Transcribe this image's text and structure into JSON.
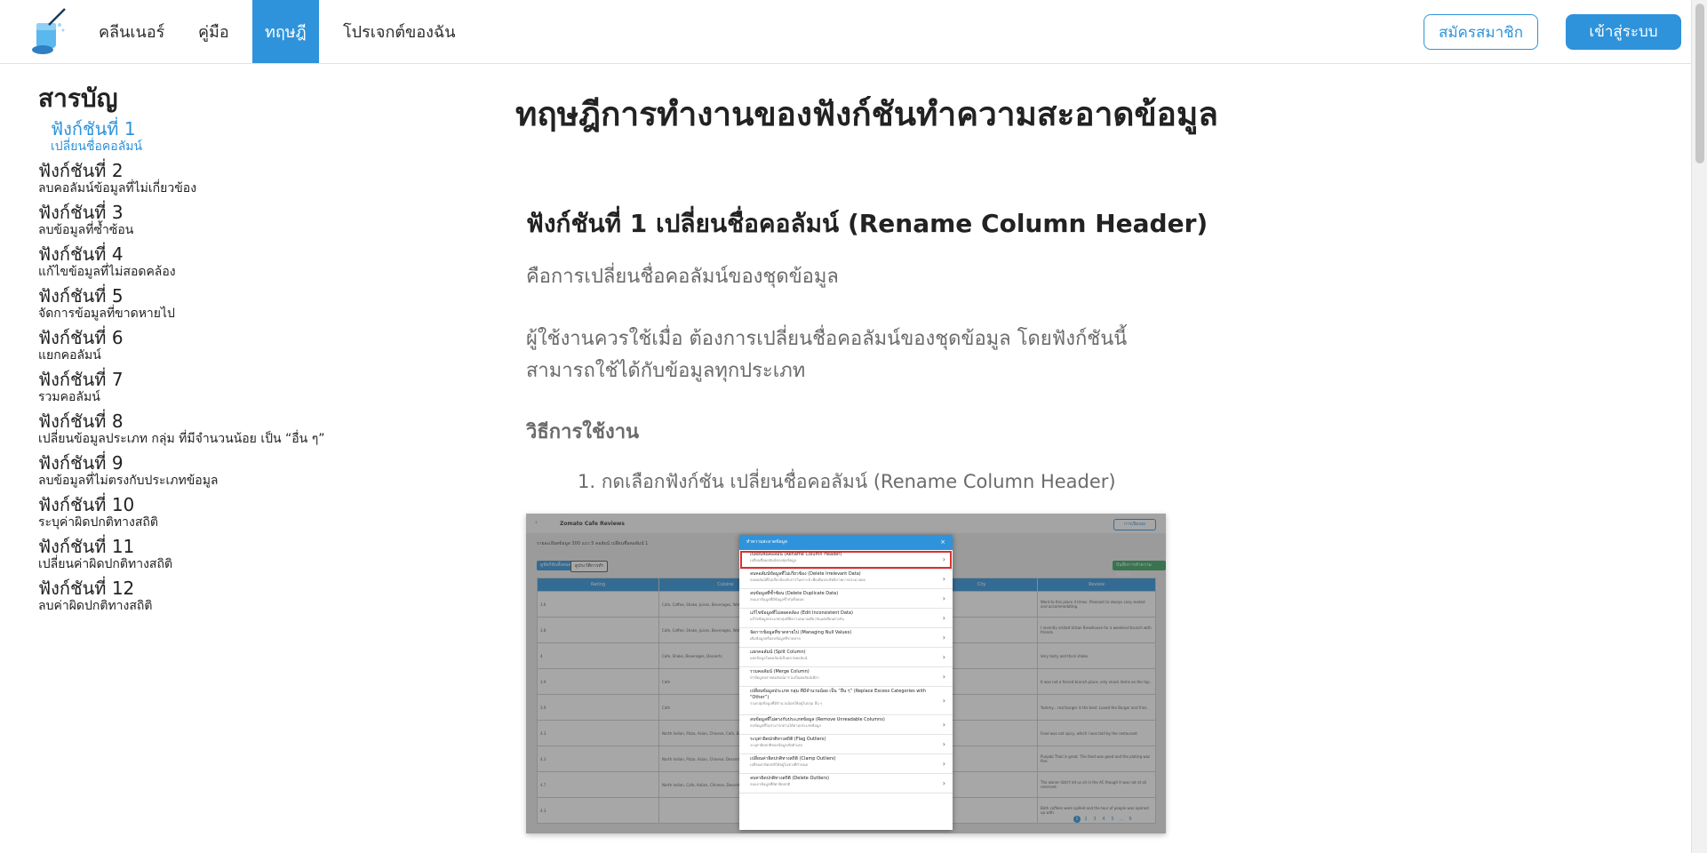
{
  "nav": {
    "links": [
      {
        "label": "คลีนเนอร์"
      },
      {
        "label": "คู่มือ"
      },
      {
        "label": "ทฤษฎี"
      },
      {
        "label": "โปรเจกต์ของฉัน"
      }
    ],
    "signup_label": "สมัครสมาชิก",
    "login_label": "เข้าสู่ระบบ"
  },
  "toc": {
    "title": "สารบัญ",
    "items": [
      {
        "num": "ฟังก์ชันที่ 1",
        "sub": "เปลี่ยนชื่อคอลัมน์"
      },
      {
        "num": "ฟังก์ชันที่ 2",
        "sub": "ลบคอลัมน์ข้อมูลที่ไม่เกี่ยวข้อง"
      },
      {
        "num": "ฟังก์ชันที่ 3",
        "sub": "ลบข้อมูลที่ซ้ำซ้อน"
      },
      {
        "num": "ฟังก์ชันที่ 4",
        "sub": "แก้ไขข้อมูลที่ไม่สอดคล้อง"
      },
      {
        "num": "ฟังก์ชันที่ 5",
        "sub": "จัดการข้อมูลที่ขาดหายไป"
      },
      {
        "num": "ฟังก์ชันที่ 6",
        "sub": "แยกคอลัมน์"
      },
      {
        "num": "ฟังก์ชันที่ 7",
        "sub": "รวมคอลัมน์"
      },
      {
        "num": "ฟังก์ชันที่ 8",
        "sub": "เปลี่ยนข้อมูลประเภท กลุ่ม ที่มีจำนวนน้อย เป็น “อื่น ๆ”"
      },
      {
        "num": "ฟังก์ชันที่ 9",
        "sub": "ลบข้อมูลที่ไม่ตรงกับประเภทข้อมูล"
      },
      {
        "num": "ฟังก์ชันที่ 10",
        "sub": "ระบุค่าผิดปกติทางสถิติ"
      },
      {
        "num": "ฟังก์ชันที่ 11",
        "sub": "เปลี่ยนค่าผิดปกติทางสถิติ"
      },
      {
        "num": "ฟังก์ชันที่ 12",
        "sub": "ลบค่าผิดปกติทางสถิติ"
      }
    ]
  },
  "main": {
    "title": "ทฤษฎีการทำงานของฟังก์ชันทำความสะอาดข้อมูล",
    "section_title": "ฟังก์ชันที่ 1 เปลี่ยนชื่อคอลัมน์ (Rename Column Header)",
    "para1": "คือการเปลี่ยนชื่อคอลัมน์ของชุดข้อมูล",
    "para2": "ผู้ใช้งานควรใช้เมื่อ ต้องการเปลี่ยนชื่อคอลัมน์ของชุดข้อมูล โดยฟังก์ชันนี้สามารถใช้ได้กับข้อมูลทุกประเภท",
    "usage_title": "วิธีการใช้งาน",
    "step1": "1. กดเลือกฟังก์ชัน เปลี่ยนชื่อคอลัมน์ (Rename Column Header)"
  },
  "screenshot": {
    "app_title": "Zomato Cafe Reviews",
    "export_label": "การเปิดเผย",
    "info": "รายละเอียดข้อมูล   300 แถว 5 คอลัมน์   เปลี่ยนชื่อคอลัมน์ 1",
    "btn_clean": "ดูฟังก์ชันทั้งหมด",
    "btn_history": "ดูประวัติการทำ",
    "btn_save": "บันทึกการทำความสะอาด",
    "columns": [
      "Rating",
      "Cuisine",
      "",
      "City",
      "Review"
    ],
    "rows": [
      [
        "3.6",
        "Cafe, Coffee, Shake, Juices, Beverages, Waffle, Ice Cream",
        "",
        "",
        "Went to this place 4 times. Pleasant to always cozy seated and accommodating."
      ],
      [
        "3.8",
        "Cafe, Coffee, Shake, Juices, Beverages, Waffle, Ice Cream",
        "",
        "",
        "I recently visited Urban Brewhouse for a weekend brunch with friends."
      ],
      [
        "4",
        "Cafe, Shake, Beverages, Desserts",
        "",
        "",
        "Very tasty and thick shake."
      ],
      [
        "3.9",
        "Cafe",
        "",
        "",
        "It was not a forced brunch place, only snack items on the top."
      ],
      [
        "3.9",
        "Cafe",
        "",
        "",
        "Yummy... real burger is the best. Loved the Burger and fries."
      ],
      [
        "4.3",
        "North Indian, Pizza, Asian, Chinese, Cafe, Burger",
        "",
        "",
        "Food was not spicy, which I was told by the restaurant."
      ],
      [
        "4.3",
        "North Indian, Pizza, Asian, Chinese, Desserts",
        "",
        "",
        "Punjabi Thali is great. The food was good and the plating was fine."
      ],
      [
        "4.7",
        "North Indian, Cafe, Italian, Chinese, Desserts",
        "",
        "",
        "The owner didn't let us sit in the AC though it was not at all reserved."
      ],
      [
        "4.3",
        "",
        "",
        "",
        "Both coffees were spilled and the tour of people was opened up with."
      ]
    ],
    "pager": [
      "1",
      "2",
      "3",
      "4",
      "5",
      "…",
      "9"
    ],
    "modal": {
      "title": "ทำความสะอาดข้อมูล",
      "close": "×",
      "items": [
        {
          "t": "เปลี่ยนชื่อคอลัมน์ (Rename Column Header)",
          "d": "เปลี่ยนชื่อคอลัมน์ของชุดข้อมูล"
        },
        {
          "t": "ลบคอลัมน์ข้อมูลที่ไม่เกี่ยวข้อง (Delete Irrelevant Data)",
          "d": "ลบคอลัมน์ที่ไม่เกี่ยวข้องกับการวิเคราะห์ เพื่อเพิ่มประสิทธิภาพการประมวลผล"
        },
        {
          "t": "ลบข้อมูลที่ซ้ำซ้อน (Delete Duplicate Data)",
          "d": "ลบแถวข้อมูลที่มีข้อมูลซ้ำกันทั้งหมด"
        },
        {
          "t": "แก้ไขข้อมูลที่ไม่สอดคล้อง (Edit Inconsistent Data)",
          "d": "แก้ไขข้อมูลประเภทกลุ่มที่มีความหมายเดียวกันแต่เขียนต่างกัน"
        },
        {
          "t": "จัดการข้อมูลที่ขาดหายไป (Managing Null Values)",
          "d": "เติมข้อมูลหรือลบข้อมูลที่ขาดหาย"
        },
        {
          "t": "แยกคอลัมน์ (Split Column)",
          "d": "แยกข้อมูลในคอลัมน์เป็นหลายคอลัมน์"
        },
        {
          "t": "รวมคอลัมน์ (Merge Column)",
          "d": "นำข้อมูลหลายคอลัมน์มารวมเป็นคอลัมน์เดียว"
        },
        {
          "t": "เปลี่ยนข้อมูลประเภท กลุ่ม ที่มีจำนวนน้อย เป็น “อื่น ๆ” (Replace Excess Categories with “Other”)",
          "d": "รวมกลุ่มข้อมูลที่มีจำนวนน้อยให้อยู่ในกลุ่ม อื่น ๆ"
        },
        {
          "t": "ลบข้อมูลที่ไม่ตรงกับประเภทข้อมูล (Remove Unreadable Columns)",
          "d": "ลบข้อมูลที่ไม่สามารถอ่านได้ตามประเภทข้อมูล"
        },
        {
          "t": "ระบุค่าผิดปกติทางสถิติ (Flag Outliers)",
          "d": "ระบุค่าผิดปกติของข้อมูลเชิงตัวเลข"
        },
        {
          "t": "เปลี่ยนค่าผิดปกติทางสถิติ (Clamp Outliers)",
          "d": "เปลี่ยนค่าผิดปกติให้อยู่ในช่วงที่กำหนด"
        },
        {
          "t": "ลบค่าผิดปกติทางสถิติ (Delete Outliers)",
          "d": "ลบแถวข้อมูลที่มีค่าผิดปกติ"
        }
      ]
    }
  },
  "colors": {
    "accent": "#2e93db",
    "highlight": "#d9302e",
    "muted_text": "#6b6b6b"
  }
}
